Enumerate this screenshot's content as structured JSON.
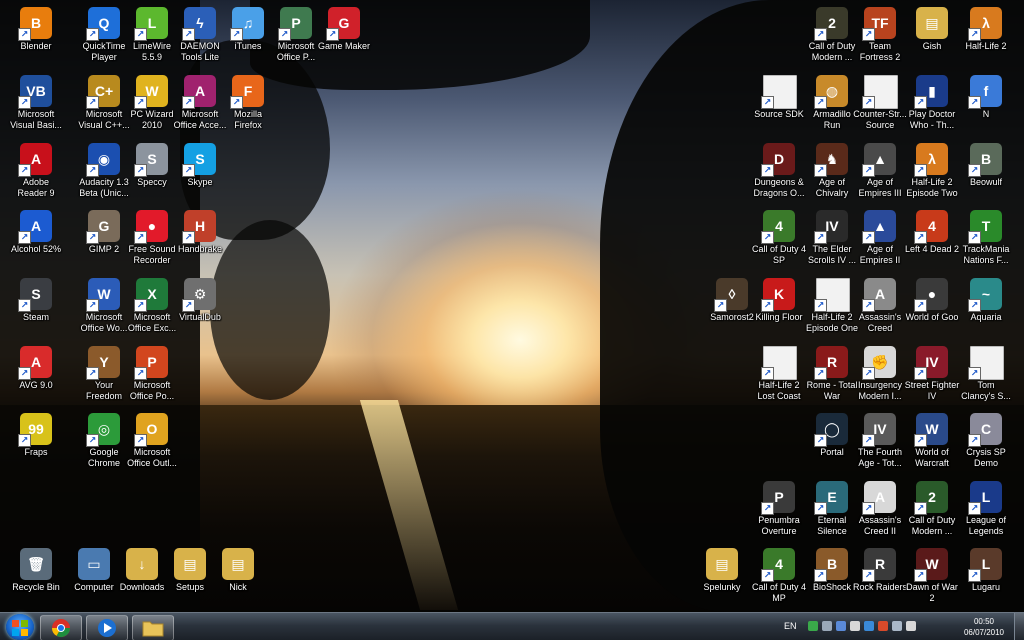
{
  "desktop": {
    "icons": [
      {
        "label": "Blender",
        "color": "#e87d0d",
        "glyph": "B",
        "icon": "blender-icon"
      },
      {
        "label": "QuickTime\nPlayer",
        "color": "#1e6fd9",
        "glyph": "Q",
        "icon": "quicktime-icon"
      },
      {
        "label": "LimeWire\n5.5.9",
        "color": "#5cb82e",
        "glyph": "L",
        "icon": "limewire-icon"
      },
      {
        "label": "DAEMON\nTools Lite",
        "color": "#2b5fb8",
        "glyph": "ϟ",
        "icon": "daemon-tools-icon"
      },
      {
        "label": "iTunes",
        "color": "#4aa0e8",
        "glyph": "♫",
        "icon": "itunes-icon"
      },
      {
        "label": "Microsoft\nOffice P...",
        "color": "#3f7a4f",
        "glyph": "P",
        "icon": "office-publisher-icon"
      },
      {
        "label": "Game Maker",
        "color": "#d0212a",
        "glyph": "G",
        "icon": "game-maker-icon"
      },
      {
        "label": "Microsoft\nVisual Basi...",
        "color": "#1f4f9c",
        "glyph": "VB",
        "icon": "visual-basic-icon"
      },
      {
        "label": "Microsoft\nVisual C++...",
        "color": "#b88a1e",
        "glyph": "C+",
        "icon": "visual-cpp-icon"
      },
      {
        "label": "PC Wizard\n2010",
        "color": "#e0b31f",
        "glyph": "W",
        "icon": "pc-wizard-icon"
      },
      {
        "label": "Microsoft\nOffice Acce...",
        "color": "#a0226e",
        "glyph": "A",
        "icon": "office-access-icon"
      },
      {
        "label": "Mozilla\nFirefox",
        "color": "#e8661a",
        "glyph": "F",
        "icon": "firefox-icon"
      },
      {
        "label": "Adobe\nReader 9",
        "color": "#c8101b",
        "glyph": "A",
        "icon": "adobe-reader-icon"
      },
      {
        "label": "Audacity 1.3\nBeta (Unic...",
        "color": "#1b4fb0",
        "glyph": "◉",
        "icon": "audacity-icon"
      },
      {
        "label": "Speccy",
        "color": "#8c949e",
        "glyph": "S",
        "icon": "speccy-icon"
      },
      {
        "label": "Skype",
        "color": "#14a0e3",
        "glyph": "S",
        "icon": "skype-icon"
      },
      {
        "label": "Alcohol 52%",
        "color": "#1c5bd1",
        "glyph": "A",
        "icon": "alcohol-icon"
      },
      {
        "label": "GIMP 2",
        "color": "#7a6b5a",
        "glyph": "G",
        "icon": "gimp-icon"
      },
      {
        "label": "Free Sound\nRecorder",
        "color": "#e21a2a",
        "glyph": "●",
        "icon": "sound-recorder-icon"
      },
      {
        "label": "Handbrake",
        "color": "#c0402a",
        "glyph": "H",
        "icon": "handbrake-icon"
      },
      {
        "label": "Steam",
        "color": "#3a3d42",
        "glyph": "S",
        "icon": "steam-icon"
      },
      {
        "label": "Microsoft\nOffice Wo...",
        "color": "#2b5cb8",
        "glyph": "W",
        "icon": "office-word-icon"
      },
      {
        "label": "Microsoft\nOffice Exc...",
        "color": "#1f7a3a",
        "glyph": "X",
        "icon": "office-excel-icon"
      },
      {
        "label": "VirtualDub",
        "color": "#6f6f6f",
        "glyph": "⚙",
        "icon": "virtualdub-icon"
      },
      {
        "label": "AVG 9.0",
        "color": "#d92b2b",
        "glyph": "A",
        "icon": "avg-icon"
      },
      {
        "label": "Your\nFreedom",
        "color": "#8b5a2b",
        "glyph": "Y",
        "icon": "your-freedom-icon"
      },
      {
        "label": "Microsoft\nOffice Po...",
        "color": "#d2461e",
        "glyph": "P",
        "icon": "office-powerpoint-icon"
      },
      {
        "label": "Fraps",
        "color": "#d8c21a",
        "glyph": "99",
        "icon": "fraps-icon"
      },
      {
        "label": "Google\nChrome",
        "color": "#2c9b3a",
        "glyph": "◎",
        "icon": "chrome-icon"
      },
      {
        "label": "Microsoft\nOffice Outl...",
        "color": "#e0a31f",
        "glyph": "O",
        "icon": "office-outlook-icon"
      },
      {
        "label": "Recycle Bin",
        "color": "#5a6b7a",
        "glyph": "🗑",
        "icon": "recycle-bin-icon"
      },
      {
        "label": "Computer",
        "color": "#4a7ab0",
        "glyph": "▭",
        "icon": "computer-icon"
      },
      {
        "label": "Downloads",
        "color": "#d8b24a",
        "glyph": "↓",
        "icon": "downloads-folder-icon"
      },
      {
        "label": "Setups",
        "color": "#d8b24a",
        "glyph": "▤",
        "icon": "setups-folder-icon"
      },
      {
        "label": "Nick",
        "color": "#d8b24a",
        "glyph": "▤",
        "icon": "nick-folder-icon"
      },
      {
        "label": "Call of Duty\nModern ...",
        "color": "#3a3a2a",
        "glyph": "2",
        "icon": "cod-modern-warfare-icon"
      },
      {
        "label": "Team\nFortress 2",
        "color": "#b8431e",
        "glyph": "TF",
        "icon": "team-fortress-icon"
      },
      {
        "label": "Gish",
        "color": "#d8b24a",
        "glyph": "▤",
        "icon": "gish-folder-icon"
      },
      {
        "label": "Half-Life 2",
        "color": "#d87a1e",
        "glyph": "λ",
        "icon": "half-life-2-icon"
      },
      {
        "label": "Source SDK",
        "color": "#f2f2f2",
        "glyph": "",
        "icon": "source-sdk-icon"
      },
      {
        "label": "Armadillo\nRun",
        "color": "#c88a2a",
        "glyph": "◍",
        "icon": "armadillo-run-icon"
      },
      {
        "label": "Counter-Str...\nSource",
        "color": "#f2f2f2",
        "glyph": "",
        "icon": "counter-strike-icon"
      },
      {
        "label": "Play Doctor\nWho - Th...",
        "color": "#1a3b8a",
        "glyph": "▮",
        "icon": "doctor-who-icon"
      },
      {
        "label": "N",
        "color": "#3a7ad8",
        "glyph": "f",
        "icon": "n-game-icon"
      },
      {
        "label": "Dungeons &\nDragons O...",
        "color": "#6a1a1a",
        "glyph": "D",
        "icon": "dungeons-dragons-icon"
      },
      {
        "label": "Age of\nChivalry",
        "color": "#5a2a1a",
        "glyph": "♞",
        "icon": "age-of-chivalry-icon"
      },
      {
        "label": "Age of\nEmpires III",
        "color": "#4a4a4a",
        "glyph": "▲",
        "icon": "age-of-empires-3-icon"
      },
      {
        "label": "Half-Life 2\nEpisode Two",
        "color": "#d87a1e",
        "glyph": "λ",
        "icon": "half-life-2-ep2-icon"
      },
      {
        "label": "Beowulf",
        "color": "#5a6a5a",
        "glyph": "B",
        "icon": "beowulf-icon"
      },
      {
        "label": "Call of Duty 4\nSP",
        "color": "#3a7a2a",
        "glyph": "4",
        "icon": "cod4-sp-icon"
      },
      {
        "label": "The Elder\nScrolls IV ...",
        "color": "#2a2a2a",
        "glyph": "IV",
        "icon": "elder-scrolls-icon"
      },
      {
        "label": "Age of\nEmpires II",
        "color": "#2a4a9a",
        "glyph": "▲",
        "icon": "age-of-empires-2-icon"
      },
      {
        "label": "Left 4 Dead 2",
        "color": "#c83a1a",
        "glyph": "4",
        "icon": "left-4-dead-icon"
      },
      {
        "label": "TrackMania\nNations F...",
        "color": "#2a8a2a",
        "glyph": "T",
        "icon": "trackmania-icon"
      },
      {
        "label": "Samorost2",
        "color": "#4a3a2a",
        "glyph": "◊",
        "icon": "samorost-icon"
      },
      {
        "label": "Killing Floor",
        "color": "#c81a1a",
        "glyph": "K",
        "icon": "killing-floor-icon"
      },
      {
        "label": "Half-Life 2\nEpisode One",
        "color": "#f2f2f2",
        "glyph": "",
        "icon": "half-life-2-ep1-icon"
      },
      {
        "label": "Assassin's\nCreed",
        "color": "#8a8a8a",
        "glyph": "A",
        "icon": "assassins-creed-icon"
      },
      {
        "label": "World of Goo",
        "color": "#3a3a3a",
        "glyph": "●",
        "icon": "world-of-goo-icon"
      },
      {
        "label": "Aquaria",
        "color": "#2a8a8a",
        "glyph": "~",
        "icon": "aquaria-icon"
      },
      {
        "label": "Half-Life 2\nLost Coast",
        "color": "#f2f2f2",
        "glyph": "",
        "icon": "half-life-2-lost-coast-icon"
      },
      {
        "label": "Rome - Total\nWar",
        "color": "#8a1a1a",
        "glyph": "R",
        "icon": "rome-total-war-icon"
      },
      {
        "label": "Insurgency\nModern I...",
        "color": "#d8d8d8",
        "glyph": "✊",
        "icon": "insurgency-icon"
      },
      {
        "label": "Street Fighter\nIV",
        "color": "#8a1a2a",
        "glyph": "IV",
        "icon": "street-fighter-icon"
      },
      {
        "label": "Tom\nClancy's S...",
        "color": "#f2f2f2",
        "glyph": "",
        "icon": "tom-clancy-icon"
      },
      {
        "label": "Portal",
        "color": "#1a2a3a",
        "glyph": "◯",
        "icon": "portal-icon"
      },
      {
        "label": "The Fourth\nAge - Tot...",
        "color": "#5a5a5a",
        "glyph": "IV",
        "icon": "fourth-age-icon"
      },
      {
        "label": "World of\nWarcraft",
        "color": "#2a4a8a",
        "glyph": "W",
        "icon": "world-of-warcraft-icon"
      },
      {
        "label": "Crysis SP\nDemo",
        "color": "#8a8a9a",
        "glyph": "C",
        "icon": "crysis-icon"
      },
      {
        "label": "Penumbra\nOverture",
        "color": "#3a3a3a",
        "glyph": "P",
        "icon": "penumbra-icon"
      },
      {
        "label": "Eternal\nSilence",
        "color": "#2a6a7a",
        "glyph": "E",
        "icon": "eternal-silence-icon"
      },
      {
        "label": "Assassin's\nCreed II",
        "color": "#d8d8d8",
        "glyph": "A",
        "icon": "assassins-creed-2-icon"
      },
      {
        "label": "Call of Duty\nModern ...",
        "color": "#2a5a2a",
        "glyph": "2",
        "icon": "cod-modern-warfare-2-icon"
      },
      {
        "label": "League of\nLegends",
        "color": "#1a3a8a",
        "glyph": "L",
        "icon": "league-of-legends-icon"
      },
      {
        "label": "Spelunky",
        "color": "#d8b24a",
        "glyph": "▤",
        "icon": "spelunky-folder-icon"
      },
      {
        "label": "Call of Duty 4\nMP",
        "color": "#3a7a2a",
        "glyph": "4",
        "icon": "cod4-mp-icon"
      },
      {
        "label": "BioShock",
        "color": "#8a5a2a",
        "glyph": "B",
        "icon": "bioshock-icon"
      },
      {
        "label": "Rock Raiders",
        "color": "#3a3a3a",
        "glyph": "R",
        "icon": "rock-raiders-icon"
      },
      {
        "label": "Dawn of War\n2",
        "color": "#5a1a1a",
        "glyph": "W",
        "icon": "dawn-of-war-icon"
      },
      {
        "label": "Lugaru",
        "color": "#5a3a2a",
        "glyph": "L",
        "icon": "lugaru-icon"
      }
    ]
  },
  "taskbar": {
    "pinned": [
      {
        "name": "chrome-taskbar-button",
        "icon": "chrome-icon"
      },
      {
        "name": "media-player-taskbar-button",
        "icon": "windows-media-player-icon"
      },
      {
        "name": "explorer-taskbar-button",
        "icon": "folder-icon"
      }
    ],
    "language": "EN",
    "time": "00:50",
    "date": "06/07/2010",
    "tray_colors": [
      "#3aa84a",
      "#9aa8b8",
      "#5a8ad8",
      "#d8d8d8",
      "#3a8ad8",
      "#d84a2a",
      "#aab8c8",
      "#d8d8d8"
    ]
  }
}
